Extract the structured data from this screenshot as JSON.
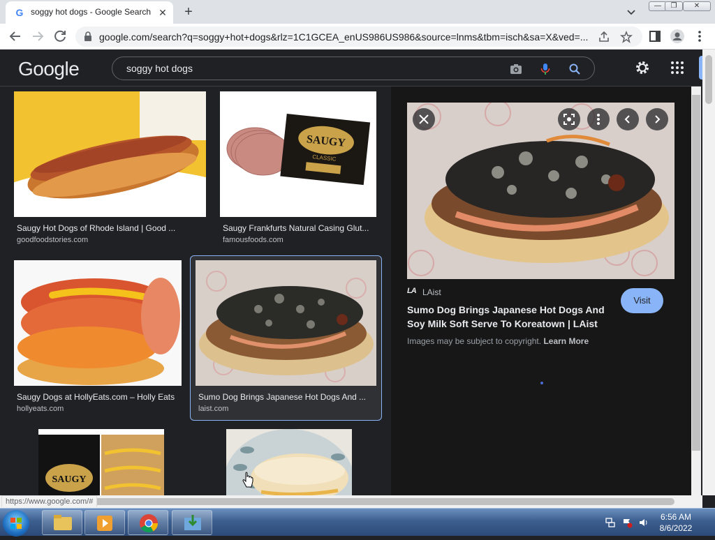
{
  "browser": {
    "tab_title": "soggy hot dogs - Google Search",
    "tab_favicon": "G",
    "url": "google.com/search?q=soggy+hot+dogs&rlz=1C1GCEA_enUS986US986&source=lnms&tbm=isch&sa=X&ved=...",
    "status_url": "https://www.google.com/#"
  },
  "google": {
    "logo": "Google",
    "query": "soggy hot dogs"
  },
  "results": [
    {
      "title": "Saugy Hot Dogs of Rhode Island | Good ...",
      "site": "goodfoodstories.com"
    },
    {
      "title": "Saugy Frankfurts Natural Casing Glut...",
      "site": "famousfoods.com"
    },
    {
      "title": "Saugy Dogs at HollyEats.com – Holly Eats",
      "site": "hollyeats.com"
    },
    {
      "title": "Sumo Dog Brings Japanese Hot Dogs And ...",
      "site": "laist.com"
    }
  ],
  "product_box": {
    "brand": "SAUGY",
    "sub": "CLASSIC",
    "small_brand": "SAUGY"
  },
  "preview": {
    "source_logo": "LA",
    "source": "LAist",
    "title": "Sumo Dog Brings Japanese Hot Dogs And Soy Milk Soft Serve To Koreatown | LAist",
    "visit": "Visit",
    "copyright": "Images may be subject to copyright.",
    "learn_more": "Learn More"
  },
  "taskbar": {
    "time": "6:56 AM",
    "date": "8/6/2022"
  },
  "colors": {
    "page_bg": "#202124",
    "preview_bg": "#171717",
    "accent": "#8ab4f8"
  }
}
